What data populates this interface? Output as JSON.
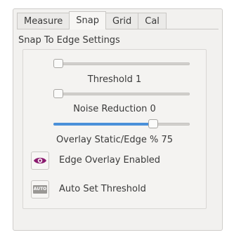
{
  "tabs": [
    {
      "label": "Measure",
      "active": false
    },
    {
      "label": "Snap",
      "active": true
    },
    {
      "label": "Grid",
      "active": false
    },
    {
      "label": "Cal",
      "active": false
    }
  ],
  "section_title": "Snap To Edge Settings",
  "sliders": [
    {
      "name": "threshold",
      "label": "Threshold 1",
      "value_fraction": 0.0
    },
    {
      "name": "noise-reduction",
      "label": "Noise Reduction 0",
      "value_fraction": 0.0
    },
    {
      "name": "overlay-static-edge",
      "label": "Overlay Static/Edge % 75",
      "value_fraction": 0.75
    }
  ],
  "buttons": {
    "edge_overlay_label": "Edge Overlay Enabled",
    "edge_overlay_icon": "eye-icon",
    "auto_threshold_label": "Auto Set Threshold",
    "auto_threshold_icon": "auto-icon",
    "auto_icon_text": "AUTO"
  },
  "colors": {
    "accent": "#4a90d9",
    "eye_icon": "#8a1a6e"
  }
}
